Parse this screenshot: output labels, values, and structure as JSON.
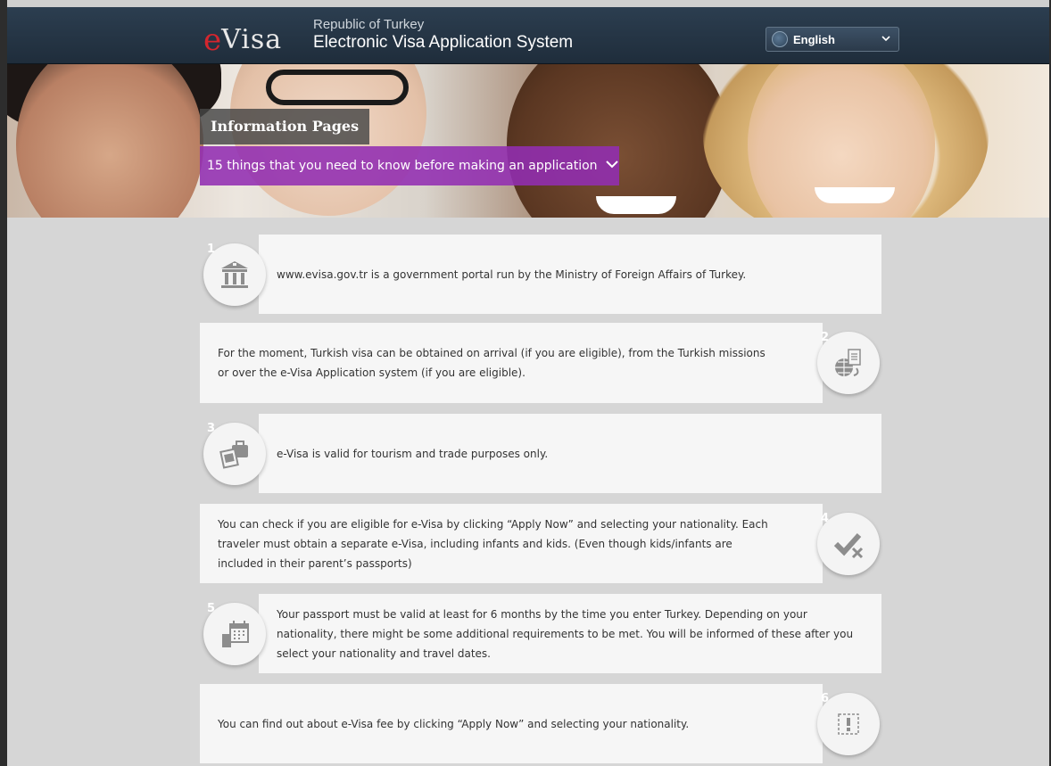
{
  "header": {
    "logo_e": "e",
    "logo_visa": "Visa",
    "subtitle": "Republic of Turkey",
    "title": "Electronic Visa Application System",
    "language": "English",
    "language_icon": "globe-icon",
    "colors": {
      "header_bg": "#2c3e50",
      "logo_red": "#d4262e"
    }
  },
  "hero": {
    "section_label": "Information Pages",
    "dropdown_label": "15 things that you need to know before making an application",
    "dropdown_color": "#922eb2"
  },
  "items": [
    {
      "number": "1",
      "icon": "government-building-icon",
      "text": "www.evisa.gov.tr is a government portal run by the Ministry of Foreign Affairs of Turkey."
    },
    {
      "number": "2",
      "icon": "globe-document-icon",
      "text": "For the moment, Turkish visa can be obtained on arrival (if you are eligible), from the Turkish missions or over the e-Visa Application system (if you are eligible)."
    },
    {
      "number": "3",
      "icon": "travel-briefcase-icon",
      "text": "e-Visa is valid for tourism and trade purposes only."
    },
    {
      "number": "4",
      "icon": "check-cross-icon",
      "text": "You can check if you are eligible for e-Visa by clicking “Apply Now” and selecting your nationality. Each traveler must obtain a separate e-Visa, including infants and kids. (Even though kids/infants are included in their parent’s passports)"
    },
    {
      "number": "5",
      "icon": "calendar-passport-icon",
      "text": "Your passport must be valid at least for 6 months by the time you enter Turkey. Depending on your nationality, there might be some additional requirements to be met. You will be informed of these after you select your nationality and travel dates."
    },
    {
      "number": "6",
      "icon": "alert-icon",
      "text": "You can find out about e-Visa fee by clicking “Apply Now” and selecting your nationality."
    }
  ]
}
